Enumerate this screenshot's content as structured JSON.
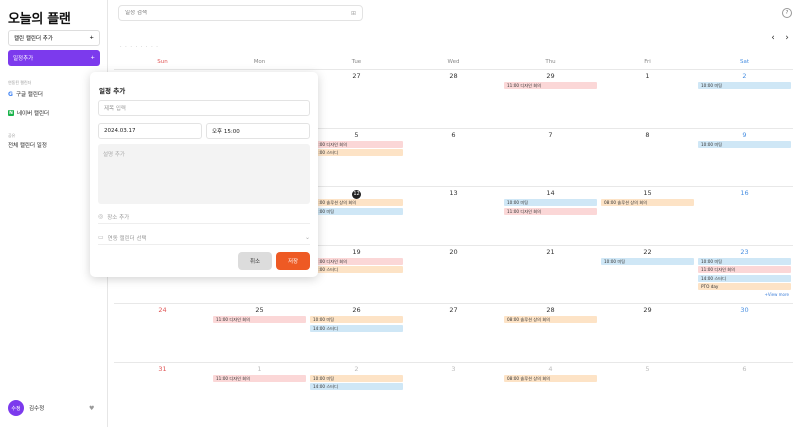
{
  "sidebar": {
    "title": "오늘의 플랜",
    "add_calendar_label": "캘린 캘린더 추가",
    "add_event_label": "일정추가",
    "plus": "+",
    "linked_section": "연동된 캘린더",
    "google_calendar": "구글 캘린더",
    "naver_calendar": "네이버 캘린더",
    "shared_section": "공유",
    "all_calendars": "전체 캘린더 일정",
    "user_avatar": "수정",
    "user_name": "김수정",
    "user_menu": "♥"
  },
  "topbar": {
    "search_placeholder": "일정 검색",
    "help": "?",
    "month_title": "· · · · · · · ·",
    "prev": "‹",
    "next": "›"
  },
  "weekdays": [
    "Sun",
    "Mon",
    "Tue",
    "Wed",
    "Thu",
    "Fri",
    "Sat"
  ],
  "weeks": [
    [
      {
        "d": "",
        "events": []
      },
      {
        "d": "",
        "events": []
      },
      {
        "d": "27",
        "events": []
      },
      {
        "d": "28",
        "events": []
      },
      {
        "d": "29",
        "events": [
          {
            "t": "11:00 디자인 회의",
            "c": "red"
          }
        ]
      },
      {
        "d": "1",
        "events": []
      },
      {
        "d": "2",
        "events": [
          {
            "t": "10:00 미팅",
            "c": "blue"
          }
        ]
      }
    ],
    [
      {
        "d": "",
        "events": []
      },
      {
        "d": "",
        "events": []
      },
      {
        "d": "5",
        "events": [
          {
            "t": "11:00 디자인 회의",
            "c": "red"
          },
          {
            "t": "14:00 스터디",
            "c": "orange"
          }
        ]
      },
      {
        "d": "6",
        "events": []
      },
      {
        "d": "7",
        "events": []
      },
      {
        "d": "8",
        "events": []
      },
      {
        "d": "9",
        "events": [
          {
            "t": "10:00 미팅",
            "c": "blue"
          }
        ]
      }
    ],
    [
      {
        "d": "",
        "events": []
      },
      {
        "d": "",
        "events": []
      },
      {
        "d": "12",
        "today": true,
        "events": [
          {
            "t": "08:00 솔루션 상의 회의",
            "c": "orange"
          },
          {
            "t": "10:00 미팅",
            "c": "blue"
          }
        ]
      },
      {
        "d": "13",
        "events": []
      },
      {
        "d": "14",
        "events": [
          {
            "t": "10:00 미팅",
            "c": "blue"
          },
          {
            "t": "11:00 디자인 회의",
            "c": "red"
          }
        ]
      },
      {
        "d": "15",
        "events": [
          {
            "t": "08:00 솔루션 상의 회의",
            "c": "orange"
          }
        ]
      },
      {
        "d": "16",
        "events": []
      }
    ],
    [
      {
        "d": "",
        "events": []
      },
      {
        "d": "",
        "events": []
      },
      {
        "d": "19",
        "events": [
          {
            "t": "11:00 디자인 회의",
            "c": "red"
          },
          {
            "t": "14:00 스터디",
            "c": "orange"
          }
        ]
      },
      {
        "d": "20",
        "events": []
      },
      {
        "d": "21",
        "events": []
      },
      {
        "d": "22",
        "events": [
          {
            "t": "10:00 미팅",
            "c": "blue"
          }
        ]
      },
      {
        "d": "23",
        "events": [
          {
            "t": "10:00 미팅",
            "c": "blue"
          },
          {
            "t": "11:00 디자인 회의",
            "c": "red"
          },
          {
            "t": "14:00 스터디",
            "c": "blue"
          },
          {
            "t": "PTO day",
            "c": "orange"
          }
        ],
        "more": "+View more"
      }
    ],
    [
      {
        "d": "24",
        "events": []
      },
      {
        "d": "25",
        "events": [
          {
            "t": "11:00 디자인 회의",
            "c": "red"
          }
        ]
      },
      {
        "d": "26",
        "events": [
          {
            "t": "10:00 미팅",
            "c": "orange"
          },
          {
            "t": "14:00 스터디",
            "c": "blue"
          }
        ]
      },
      {
        "d": "27",
        "events": []
      },
      {
        "d": "28",
        "events": [
          {
            "t": "08:00 솔루션 상의 회의",
            "c": "orange"
          }
        ]
      },
      {
        "d": "29",
        "events": []
      },
      {
        "d": "30",
        "events": []
      }
    ],
    [
      {
        "d": "31",
        "events": []
      },
      {
        "d": "1",
        "dim": true,
        "events": [
          {
            "t": "11:00 디자인 회의",
            "c": "red"
          }
        ]
      },
      {
        "d": "2",
        "dim": true,
        "events": [
          {
            "t": "10:00 미팅",
            "c": "orange"
          },
          {
            "t": "14:00 스터디",
            "c": "blue"
          }
        ]
      },
      {
        "d": "3",
        "dim": true,
        "events": []
      },
      {
        "d": "4",
        "dim": true,
        "events": [
          {
            "t": "08:00 솔루션 상의 회의",
            "c": "orange"
          }
        ]
      },
      {
        "d": "5",
        "dim": true,
        "events": []
      },
      {
        "d": "6",
        "dim": true,
        "events": []
      }
    ]
  ],
  "modal": {
    "title": "일정 추가",
    "title_placeholder": "제목 입력",
    "date": "2024.03.17",
    "time": "오후 15:00",
    "desc_placeholder": "설명 추가",
    "location_placeholder": "장소 추가",
    "calendar_select": "연동 캘린더 선택",
    "cancel": "취소",
    "save": "저장"
  }
}
